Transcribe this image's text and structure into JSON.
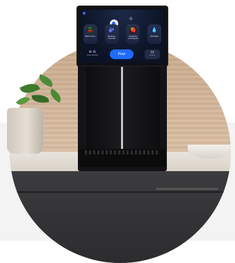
{
  "screen": {
    "top_icons": [
      {
        "name": "water-drop-icon",
        "label": ""
      },
      {
        "name": "sparkling-icon",
        "label": "Bubbles"
      }
    ],
    "flavors": [
      {
        "label": "Black Cherry",
        "icon": "cherry-icon",
        "glyph": "🍒",
        "color": "#3ea04f"
      },
      {
        "label": "Blueberry Lavender",
        "icon": "blueberry-icon",
        "glyph": "🫐",
        "color": "#3a7cf0"
      },
      {
        "label": "Raspberry Lemongrass",
        "icon": "raspberry-icon",
        "glyph": "🍓",
        "color": "#e24444"
      },
      {
        "label": "Still Water",
        "icon": "water-icon",
        "glyph": "💧",
        "color": "#3a6cf0"
      }
    ],
    "controls": {
      "left_label": "Temp Bubbles",
      "pour_label": "Pour",
      "volume_value": "12",
      "volume_label": "Volume"
    }
  }
}
